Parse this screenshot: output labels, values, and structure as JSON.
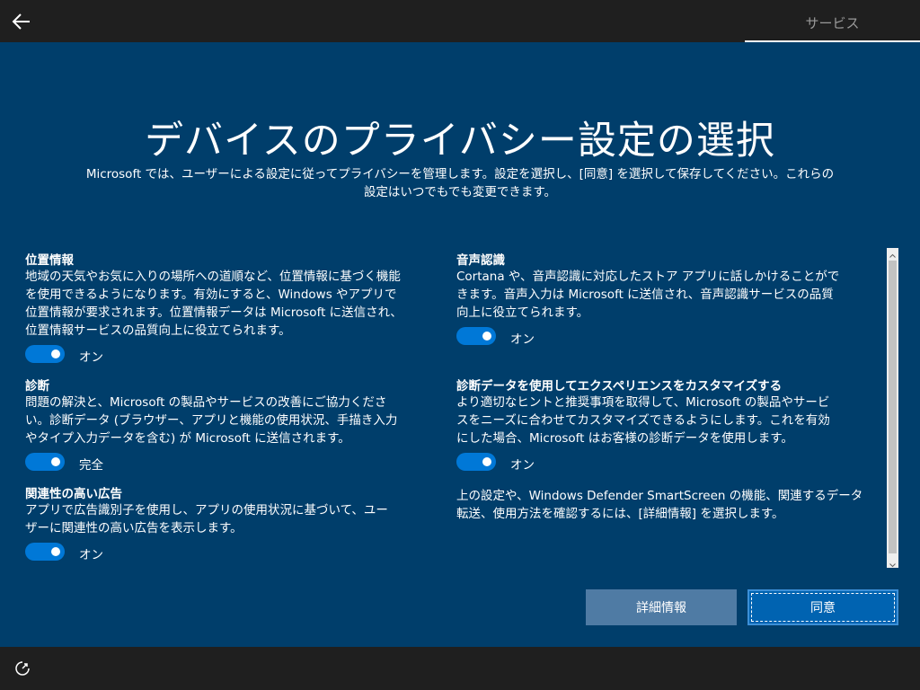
{
  "header": {
    "tab_label": "サービス"
  },
  "title": "デバイスのプライバシー設定の選択",
  "intro_line1": "Microsoft では、ユーザーによる設定に従ってプライバシーを管理します。設定を選択し、[同意] を選択して保存してください。これらの",
  "intro_line2": "設定はいつでもでも変更できます。",
  "settings": {
    "location": {
      "title": "位置情報",
      "desc": [
        "地域の天気やお気に入りの場所への道順など、位置情報に基づく機能",
        "を使用できるようになります。有効にすると、Windows やアプリで",
        "位置情報が要求されます。位置情報データは Microsoft に送信され、",
        "位置情報サービスの品質向上に役立てられます。"
      ],
      "state": "オン"
    },
    "diagnostics": {
      "title": "診断",
      "desc": [
        "問題の解決と、Microsoft の製品やサービスの改善にご協力くださ",
        "い。診断データ (ブラウザー、アプリと機能の使用状況、手描き入力",
        "やタイプ入力データを含む) が Microsoft に送信されます。"
      ],
      "state": "完全"
    },
    "ads": {
      "title": "関連性の高い広告",
      "desc": [
        "アプリで広告識別子を使用し、アプリの使用状況に基づいて、ユー",
        "ザーに関連性の高い広告を表示します。"
      ],
      "state": "オン"
    },
    "speech": {
      "title": "音声認識",
      "desc": [
        "Cortana や、音声認識に対応したストア アプリに話しかけることがで",
        "きます。音声入力は Microsoft に送信され、音声認識サービスの品質",
        "向上に役立てられます。"
      ],
      "state": "オン"
    },
    "tailored": {
      "title": "診断データを使用してエクスペリエンスをカスタマイズする",
      "desc": [
        "より適切なヒントと推奨事項を取得して、Microsoft の製品やサービ",
        "スをニーズに合わせてカスタマイズできるようにします。これを有効",
        "にした場合、Microsoft はお客様の診断データを使用します。"
      ],
      "state": "オン"
    }
  },
  "footnote": [
    "上の設定や、Windows Defender SmartScreen の機能、関連するデータ",
    "転送、使用方法を確認するには、[詳細情報] を選択します。"
  ],
  "buttons": {
    "details": "詳細情報",
    "accept": "同意"
  },
  "colors": {
    "background": "#003e6b",
    "bar": "#1f1f1f",
    "toggle_on": "#0078d7",
    "accept_button": "#0063b1",
    "details_button": "#4f7ba4"
  },
  "icons": {
    "back": "back-arrow-icon",
    "ease_of_access": "ease-of-access-icon"
  }
}
